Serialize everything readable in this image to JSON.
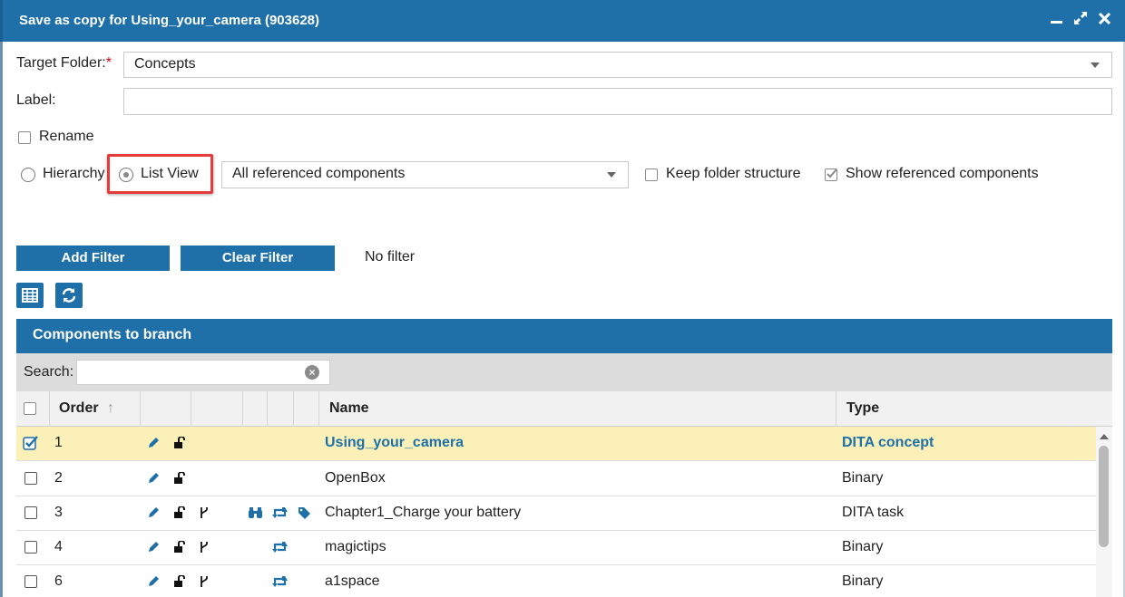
{
  "window": {
    "title": "Save as copy for Using_your_camera (903628)",
    "controls": [
      "minimize-icon",
      "maximize-icon",
      "close-icon"
    ]
  },
  "form": {
    "target_folder_label": "Target Folder:",
    "required_mark": "*",
    "target_folder_value": "Concepts",
    "label_label": "Label:",
    "label_value": "",
    "rename_label": "Rename",
    "rename_checked": false
  },
  "view_options": {
    "hierarchy_label": "Hierarchy",
    "list_view_label": "List View",
    "selected": "List View",
    "components_select_value": "All referenced components",
    "keep_folder_label": "Keep folder structure",
    "keep_folder_checked": false,
    "show_referenced_label": "Show referenced components",
    "show_referenced_checked": true
  },
  "filter": {
    "add_label": "Add Filter",
    "clear_label": "Clear Filter",
    "status": "No filter"
  },
  "toolbar_icons": [
    "table-icon",
    "refresh-icon"
  ],
  "panel": {
    "title": "Components to branch",
    "search_label": "Search:",
    "search_value": ""
  },
  "table": {
    "columns": [
      "Order",
      "Name",
      "Type"
    ],
    "sort_indicator": "↑",
    "rows": [
      {
        "checked": true,
        "order": "1",
        "name": "Using_your_camera",
        "type": "DITA concept",
        "icons": [
          "pencil-icon",
          "unlock-icon"
        ],
        "selected": true
      },
      {
        "checked": false,
        "order": "2",
        "name": "OpenBox",
        "type": "Binary",
        "icons": [
          "pencil-icon",
          "unlock-icon"
        ],
        "selected": false
      },
      {
        "checked": false,
        "order": "3",
        "name": "Chapter1_Charge your battery",
        "type": "DITA task",
        "icons": [
          "pencil-icon",
          "unlock-icon",
          "branch-icon",
          "binoculars-icon",
          "retweet-icon",
          "tags-icon"
        ],
        "selected": false
      },
      {
        "checked": false,
        "order": "4",
        "name": "magictips",
        "type": "Binary",
        "icons": [
          "pencil-icon",
          "unlock-icon",
          "branch-icon",
          "retweet-icon"
        ],
        "selected": false
      },
      {
        "checked": false,
        "order": "6",
        "name": "a1space",
        "type": "Binary",
        "icons": [
          "pencil-icon",
          "unlock-icon",
          "branch-icon",
          "retweet-icon"
        ],
        "selected": false
      }
    ]
  },
  "colors": {
    "accent": "#1f6fa8",
    "selected_row": "#fbf1b8",
    "highlight_border": "#e53b3b",
    "required": "#d0021b"
  }
}
